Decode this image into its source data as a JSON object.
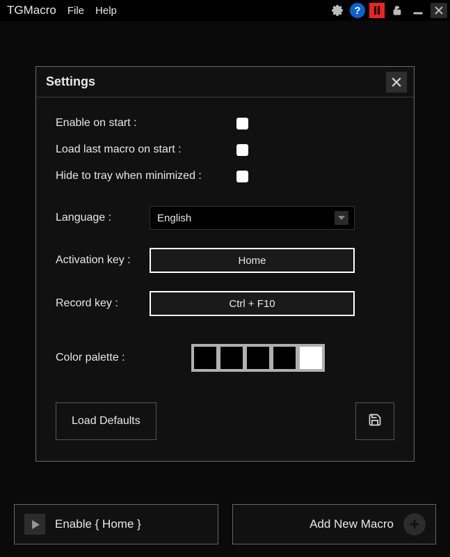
{
  "app": {
    "title": "TGMacro"
  },
  "menu": {
    "file": "File",
    "help": "Help"
  },
  "settings": {
    "title": "Settings",
    "enable_on_start_label": "Enable on start :",
    "load_last_label": "Load last macro on start :",
    "hide_to_tray_label": "Hide to tray when minimized :",
    "language_label": "Language :",
    "language_value": "English",
    "activation_key_label": "Activation key :",
    "activation_key_value": "Home",
    "record_key_label": "Record key :",
    "record_key_value": "Ctrl + F10",
    "color_palette_label": "Color palette :",
    "palette": [
      "#000000",
      "#000000",
      "#000000",
      "#000000",
      "#ffffff"
    ],
    "load_defaults_label": "Load Defaults"
  },
  "bottom": {
    "enable_label": "Enable { Home }",
    "add_label": "Add New Macro"
  }
}
